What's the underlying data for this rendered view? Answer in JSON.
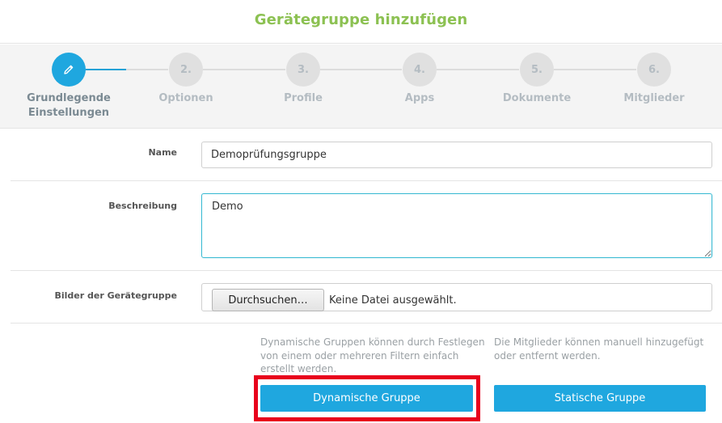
{
  "header": {
    "title": "Gerätegruppe hinzufügen"
  },
  "wizard": {
    "steps": [
      {
        "number": "",
        "label_line1": "Grundlegende",
        "label_line2": "Einstellungen",
        "active": true,
        "icon": "pencil-icon"
      },
      {
        "number": "2.",
        "label_line1": "Optionen",
        "label_line2": "",
        "active": false
      },
      {
        "number": "3.",
        "label_line1": "Profile",
        "label_line2": "",
        "active": false
      },
      {
        "number": "4.",
        "label_line1": "Apps",
        "label_line2": "",
        "active": false
      },
      {
        "number": "5.",
        "label_line1": "Dokumente",
        "label_line2": "",
        "active": false
      },
      {
        "number": "6.",
        "label_line1": "Mitglieder",
        "label_line2": "",
        "active": false
      }
    ]
  },
  "form": {
    "name": {
      "label": "Name",
      "value": "Demoprüfungsgruppe"
    },
    "description": {
      "label": "Beschreibung",
      "value": "Demo"
    },
    "images": {
      "label": "Bilder der Gerätegruppe",
      "browse_label": "Durchsuchen…",
      "status": "Keine Datei ausgewählt."
    }
  },
  "group_types": {
    "dynamic": {
      "desc_line1": "Dynamische Gruppen können durch Festlegen",
      "desc_line2": "von einem oder mehreren Filtern einfach",
      "desc_line3": "erstellt werden.",
      "button_label": "Dynamische Gruppe"
    },
    "static": {
      "desc_line1": "Die Mitglieder können manuell hinzugefügt",
      "desc_line2": "oder entfernt werden.",
      "button_label": "Statische Gruppe"
    }
  },
  "colors": {
    "accent": "#1fa7df",
    "title_green": "#8cc152",
    "highlight": "#e8001c"
  }
}
